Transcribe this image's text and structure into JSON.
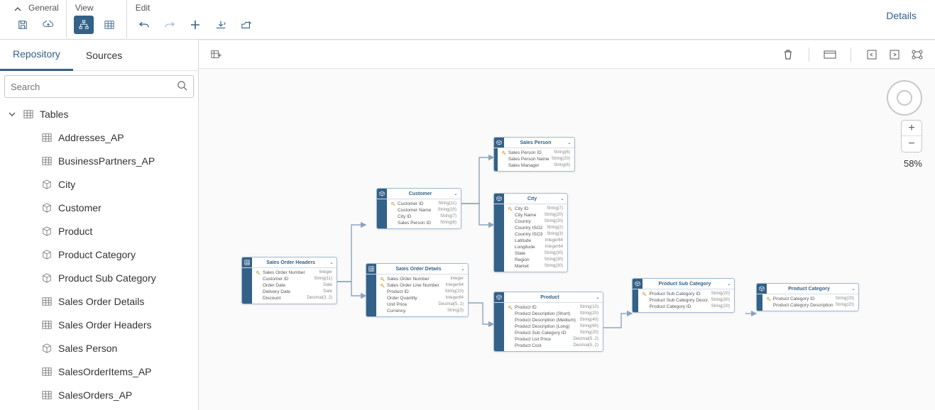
{
  "toolbar": {
    "groups": {
      "general": "General",
      "view": "View",
      "edit": "Edit"
    },
    "details": "Details"
  },
  "sidebar": {
    "tabs": {
      "repository": "Repository",
      "sources": "Sources"
    },
    "search_placeholder": "Search",
    "root": "Tables",
    "items": [
      {
        "label": "Addresses_AP",
        "icon": "table"
      },
      {
        "label": "BusinessPartners_AP",
        "icon": "table"
      },
      {
        "label": "City",
        "icon": "cube"
      },
      {
        "label": "Customer",
        "icon": "cube"
      },
      {
        "label": "Product",
        "icon": "cube"
      },
      {
        "label": "Product Category",
        "icon": "cube"
      },
      {
        "label": "Product Sub Category",
        "icon": "cube"
      },
      {
        "label": "Sales Order Details",
        "icon": "table"
      },
      {
        "label": "Sales Order Headers",
        "icon": "table"
      },
      {
        "label": "Sales Person",
        "icon": "cube"
      },
      {
        "label": "SalesOrderItems_AP",
        "icon": "table"
      },
      {
        "label": "SalesOrders_AP",
        "icon": "table"
      }
    ]
  },
  "zoom": "58%",
  "nodes": {
    "soh": {
      "title": "Sales Order Headers",
      "fields": [
        {
          "name": "Sales Order Number",
          "type": "Integer",
          "key": true
        },
        {
          "name": "Customer ID",
          "type": "String(11)",
          "key": false
        },
        {
          "name": "Order Date",
          "type": "Date",
          "key": false
        },
        {
          "name": "Delivery Date",
          "type": "Date",
          "key": false
        },
        {
          "name": "Discount",
          "type": "Decimal(3, 2)",
          "key": false
        }
      ]
    },
    "customer": {
      "title": "Customer",
      "fields": [
        {
          "name": "Customer ID",
          "type": "String(11)",
          "key": true
        },
        {
          "name": "Customer Name",
          "type": "String(20)",
          "key": false
        },
        {
          "name": "City ID",
          "type": "String(7)",
          "key": false
        },
        {
          "name": "Sales Person ID",
          "type": "String(6)",
          "key": false
        }
      ]
    },
    "sod": {
      "title": "Sales Order Details",
      "fields": [
        {
          "name": "Sales Order Number",
          "type": "Integer",
          "key": true
        },
        {
          "name": "Sales Order Line Number",
          "type": "Integer64",
          "key": true
        },
        {
          "name": "Product ID",
          "type": "String(10)",
          "key": false
        },
        {
          "name": "Order Quantity",
          "type": "Integer64",
          "key": false
        },
        {
          "name": "Unit Price",
          "type": "Decimal(5, 2)",
          "key": false
        },
        {
          "name": "Currency",
          "type": "String(3)",
          "key": false
        }
      ]
    },
    "sp": {
      "title": "Sales Person",
      "fields": [
        {
          "name": "Sales Person ID",
          "type": "String(6)",
          "key": true
        },
        {
          "name": "Sales Person Name",
          "type": "String(20)",
          "key": false
        },
        {
          "name": "Sales Manager",
          "type": "String(6)",
          "key": false
        }
      ]
    },
    "city": {
      "title": "City",
      "fields": [
        {
          "name": "City ID",
          "type": "String(7)",
          "key": true
        },
        {
          "name": "City Name",
          "type": "String(20)",
          "key": false
        },
        {
          "name": "Country",
          "type": "String(20)",
          "key": false
        },
        {
          "name": "Country ISO2",
          "type": "String(2)",
          "key": false
        },
        {
          "name": "Country ISO3",
          "type": "String(3)",
          "key": false
        },
        {
          "name": "Latitude",
          "type": "Integer64",
          "key": false
        },
        {
          "name": "Longitude",
          "type": "Integer64",
          "key": false
        },
        {
          "name": "State",
          "type": "String(30)",
          "key": false
        },
        {
          "name": "Region",
          "type": "String(30)",
          "key": false
        },
        {
          "name": "Market",
          "type": "String(30)",
          "key": false
        }
      ]
    },
    "product": {
      "title": "Product",
      "fields": [
        {
          "name": "Product ID",
          "type": "String(10)",
          "key": true
        },
        {
          "name": "Product Description (Short)",
          "type": "String(20)",
          "key": false
        },
        {
          "name": "Product Description (Medium)",
          "type": "String(40)",
          "key": false
        },
        {
          "name": "Product Description (Long)",
          "type": "String(60)",
          "key": false
        },
        {
          "name": "Product Sub Category ID",
          "type": "String(20)",
          "key": false
        },
        {
          "name": "Product List Price",
          "type": "Decimal(5, 2)",
          "key": false
        },
        {
          "name": "Product Cost",
          "type": "Decimal(5, 2)",
          "key": false
        }
      ]
    },
    "psc": {
      "title": "Product Sub Category",
      "fields": [
        {
          "name": "Product Sub Category ID",
          "type": "String(20)",
          "key": true
        },
        {
          "name": "Product Sub Category Descr.",
          "type": "String(30)",
          "key": false
        },
        {
          "name": "Product Category ID",
          "type": "String(20)",
          "key": false
        }
      ]
    },
    "pc": {
      "title": "Product Category",
      "fields": [
        {
          "name": "Product Category ID",
          "type": "String(20)",
          "key": true
        },
        {
          "name": "Product Category Description",
          "type": "String(20)",
          "key": false
        }
      ]
    }
  }
}
